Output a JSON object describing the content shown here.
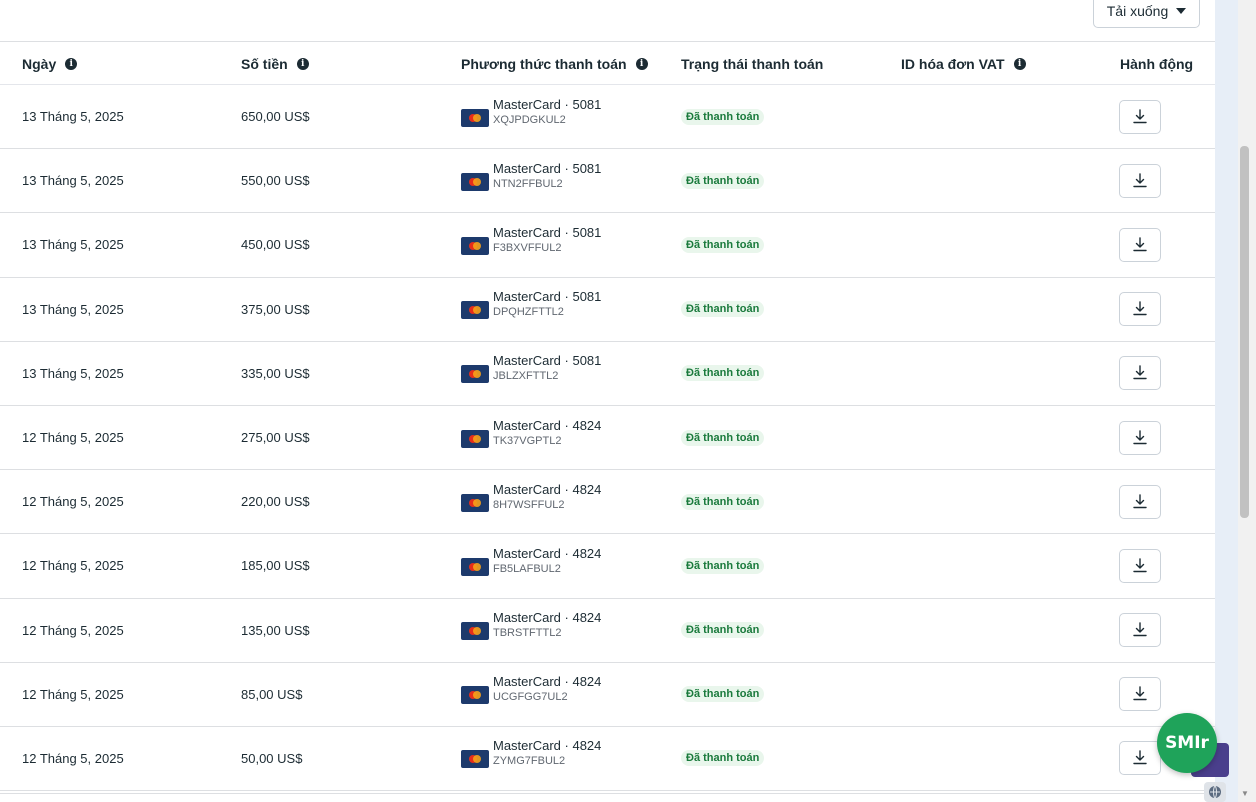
{
  "toolbar": {
    "download_label": "Tải xuống"
  },
  "columns": {
    "date": "Ngày",
    "amount": "Số tiền",
    "payment_method": "Phương thức thanh toán",
    "status": "Trạng thái thanh toán",
    "vat_id": "ID hóa đơn VAT",
    "action": "Hành động"
  },
  "rows": [
    {
      "date": "13 Tháng 5, 2025",
      "amount": "650,00 US$",
      "card": "MasterCard · 5081",
      "code": "XQJPDGKUL2",
      "status": "Đã thanh toán"
    },
    {
      "date": "13 Tháng 5, 2025",
      "amount": "550,00 US$",
      "card": "MasterCard · 5081",
      "code": "NTN2FFBUL2",
      "status": "Đã thanh toán"
    },
    {
      "date": "13 Tháng 5, 2025",
      "amount": "450,00 US$",
      "card": "MasterCard · 5081",
      "code": "F3BXVFFUL2",
      "status": "Đã thanh toán"
    },
    {
      "date": "13 Tháng 5, 2025",
      "amount": "375,00 US$",
      "card": "MasterCard · 5081",
      "code": "DPQHZFTTL2",
      "status": "Đã thanh toán"
    },
    {
      "date": "13 Tháng 5, 2025",
      "amount": "335,00 US$",
      "card": "MasterCard · 5081",
      "code": "JBLZXFTTL2",
      "status": "Đã thanh toán"
    },
    {
      "date": "12 Tháng 5, 2025",
      "amount": "275,00 US$",
      "card": "MasterCard · 4824",
      "code": "TK37VGPTL2",
      "status": "Đã thanh toán"
    },
    {
      "date": "12 Tháng 5, 2025",
      "amount": "220,00 US$",
      "card": "MasterCard · 4824",
      "code": "8H7WSFFUL2",
      "status": "Đã thanh toán"
    },
    {
      "date": "12 Tháng 5, 2025",
      "amount": "185,00 US$",
      "card": "MasterCard · 4824",
      "code": "FB5LAFBUL2",
      "status": "Đã thanh toán"
    },
    {
      "date": "12 Tháng 5, 2025",
      "amount": "135,00 US$",
      "card": "MasterCard · 4824",
      "code": "TBRSTFTTL2",
      "status": "Đã thanh toán"
    },
    {
      "date": "12 Tháng 5, 2025",
      "amount": "85,00 US$",
      "card": "MasterCard · 4824",
      "code": "UCGFGG7UL2",
      "status": "Đã thanh toán"
    },
    {
      "date": "12 Tháng 5, 2025",
      "amount": "50,00 US$",
      "card": "MasterCard · 4824",
      "code": "ZYMG7FBUL2",
      "status": "Đã thanh toán"
    }
  ],
  "widget": {
    "label": "SMIr"
  },
  "icons": {
    "info": "info-icon",
    "download": "download-icon",
    "card": "mastercard-icon",
    "globe": "globe-icon"
  },
  "colors": {
    "status_bg": "#e9f6ec",
    "status_text": "#1a7a3c",
    "widget_green": "#1fa35a",
    "card_blue": "#1d3a6c"
  }
}
